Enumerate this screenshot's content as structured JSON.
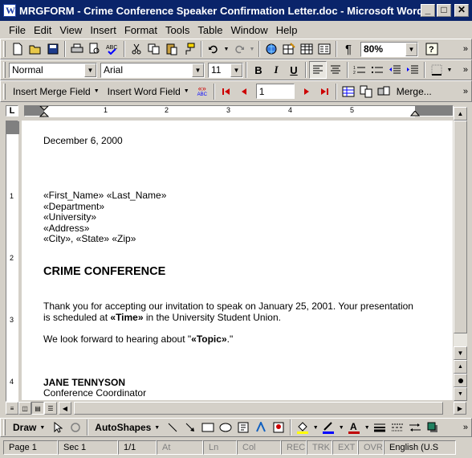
{
  "window": {
    "title": "MRGFORM - Crime Conference Speaker Confirmation Letter.doc - Microsoft Word",
    "minimize": "_",
    "maximize": "□",
    "close": "✕"
  },
  "menu": [
    "File",
    "Edit",
    "View",
    "Insert",
    "Format",
    "Tools",
    "Table",
    "Window",
    "Help"
  ],
  "standard_toolbar": {
    "zoom": "80%",
    "icons": [
      "new-icon",
      "open-icon",
      "save-icon",
      "print-icon",
      "print-preview-icon",
      "spelling-icon",
      "cut-icon",
      "copy-icon",
      "paste-icon",
      "format-painter-icon",
      "undo-icon",
      "redo-icon",
      "hyperlink-icon",
      "tables-borders-icon",
      "insert-table-icon",
      "columns-icon",
      "show-hide-icon",
      "help-icon"
    ],
    "show_hide_label": "¶"
  },
  "formatting_toolbar": {
    "style": "Normal",
    "font": "Arial",
    "size": "11",
    "bold": "B",
    "italic": "I",
    "underline": "U"
  },
  "mail_merge_toolbar": {
    "insert_merge_field": "Insert Merge Field",
    "insert_word_field": "Insert Word Field",
    "abc_label": "«»",
    "abc_sub": "ABC",
    "record": "1",
    "merge_button": "Merge..."
  },
  "ruler": {
    "corner": "L",
    "numbers": [
      "1",
      "2",
      "3",
      "4",
      "5"
    ],
    "vnumbers": [
      "1",
      "2",
      "3",
      "4"
    ]
  },
  "document": {
    "date": "December 6, 2000",
    "address": [
      "«First_Name» «Last_Name»",
      "«Department»",
      "«University»",
      "«Address»",
      "«City», «State» «Zip»"
    ],
    "heading": "CRIME CONFERENCE",
    "para1_line1": "Thank you for accepting our invitation to speak on January 25, 2001. Your presentation",
    "para1_line2_pre": "is scheduled at ",
    "para1_line2_field": "«Time»",
    "para1_line2_post": " in the University Student Union.",
    "para2_pre": "We look forward to hearing about \"",
    "para2_field": "«Topic»",
    "para2_post": ".\"",
    "signature_name": "JANE TENNYSON",
    "signature_title": "Conference Coordinator"
  },
  "drawing_toolbar": {
    "draw": "Draw",
    "autoshapes": "AutoShapes"
  },
  "status_bar": {
    "page": "Page  1",
    "sec": "Sec  1",
    "pages": "1/1",
    "at": "At",
    "ln": "Ln",
    "col": "Col",
    "rec": "REC",
    "trk": "TRK",
    "ext": "EXT",
    "ovr": "OVR",
    "language": "English (U.S"
  }
}
